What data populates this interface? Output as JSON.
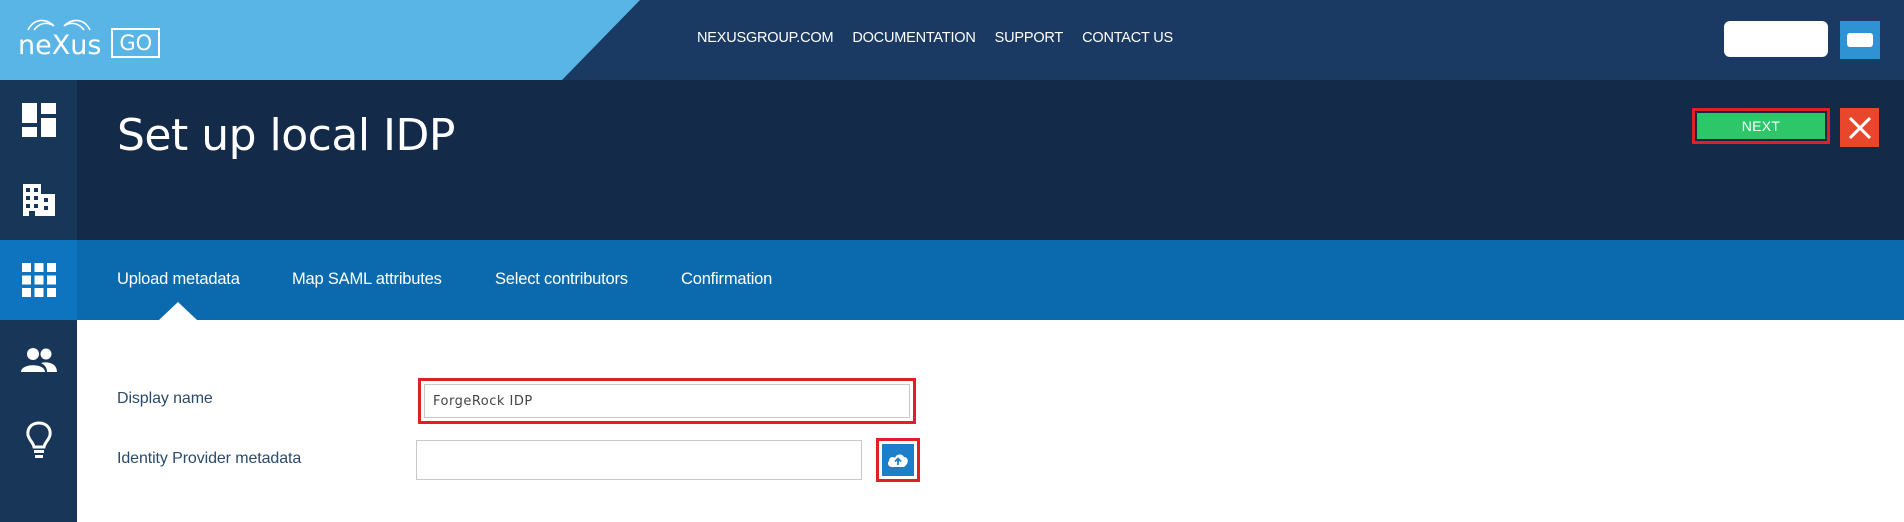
{
  "brand": {
    "logo_text": "neXus",
    "logo_badge": "GO"
  },
  "topnav": {
    "items": [
      "NEXUSGROUP.COM",
      "DOCUMENTATION",
      "SUPPORT",
      "CONTACT US"
    ]
  },
  "sidebar": {
    "items": [
      {
        "icon": "dashboard-icon",
        "active": false
      },
      {
        "icon": "building-icon",
        "active": false
      },
      {
        "icon": "apps-grid-icon",
        "active": true
      },
      {
        "icon": "users-icon",
        "active": false
      },
      {
        "icon": "lightbulb-icon",
        "active": false
      }
    ]
  },
  "header": {
    "title": "Set up local IDP",
    "next_label": "NEXT"
  },
  "tabs": {
    "items": [
      "Upload metadata",
      "Map SAML attributes",
      "Select contributors",
      "Confirmation"
    ],
    "active_index": 0
  },
  "form": {
    "display_name_label": "Display name",
    "display_name_value": "ForgeRock IDP",
    "metadata_label": "Identity Provider metadata",
    "metadata_value": ""
  },
  "colors": {
    "topbar": "#1a3a63",
    "logo_bg": "#58b5e6",
    "header": "#132a48",
    "tabs": "#0a6aad",
    "sidebar": "#173658",
    "sidebar_active": "#0f74bf",
    "next": "#2dc76a",
    "close": "#e8472b",
    "highlight": "#e21e26"
  }
}
